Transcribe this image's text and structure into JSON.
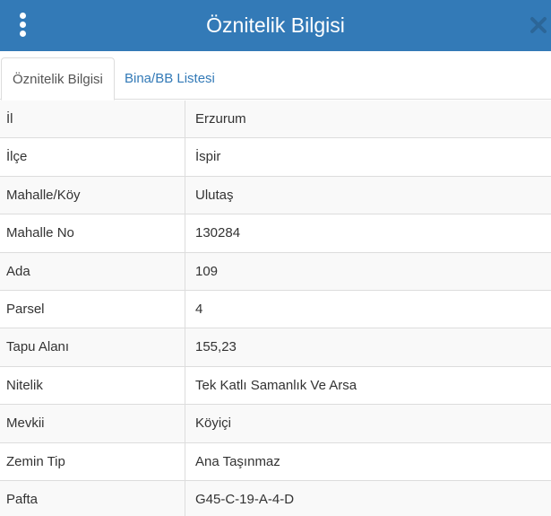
{
  "header": {
    "title": "Öznitelik Bilgisi",
    "menu_icon": "vertical-ellipsis",
    "close_icon": "close-x",
    "background_color": "#337ab7"
  },
  "tabs": [
    {
      "label": "Öznitelik Bilgisi",
      "active": true
    },
    {
      "label": "Bina/BB Listesi",
      "active": false
    }
  ],
  "attributes": [
    {
      "key": "İl",
      "value": "Erzurum"
    },
    {
      "key": "İlçe",
      "value": "İspir"
    },
    {
      "key": "Mahalle/Köy",
      "value": "Ulutaş"
    },
    {
      "key": "Mahalle No",
      "value": "130284"
    },
    {
      "key": "Ada",
      "value": "109"
    },
    {
      "key": "Parsel",
      "value": "4"
    },
    {
      "key": "Tapu Alanı",
      "value": "155,23"
    },
    {
      "key": "Nitelik",
      "value": "Tek Katlı Samanlık Ve Arsa"
    },
    {
      "key": "Mevkii",
      "value": "Köyiçi"
    },
    {
      "key": "Zemin Tip",
      "value": "Ana Taşınmaz"
    },
    {
      "key": "Pafta",
      "value": "G45-C-19-A-4-D"
    }
  ]
}
